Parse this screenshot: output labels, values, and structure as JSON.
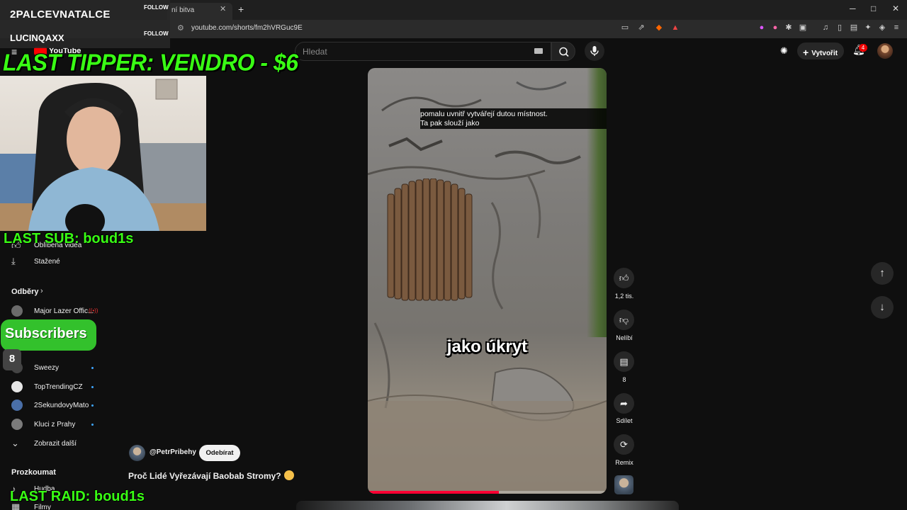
{
  "browser": {
    "tab_title": "ní bitva",
    "tab_close": "✕",
    "new_tab": "+",
    "url": "youtube.com/shorts/fm2hVRGuc9E",
    "win_min": "─",
    "win_max": "□",
    "win_close": "✕"
  },
  "header": {
    "logo_text": "YouTube",
    "search_placeholder": "Hledat",
    "create_label": "Vytvořit",
    "notification_count": "4"
  },
  "sidebar": {
    "partial_item": "Oblíbená videa",
    "downloads": "Stažené",
    "subscriptions_heading": "Odběry",
    "subs": [
      {
        "name": "Major Lazer Offic...",
        "color": "#6b6b6b"
      },
      {
        "name": "Sweezy",
        "color": "#444444"
      },
      {
        "name": "TopTrendingCZ",
        "color": "#e6e6e6"
      },
      {
        "name": "2SekundovyMato",
        "color": "#4a6fa8"
      },
      {
        "name": "Kluci z Prahy",
        "color": "#7b7b7b"
      }
    ],
    "show_more": "Zobrazit další",
    "explore_heading": "Prozkoumat",
    "music": "Hudba",
    "movies": "Filmy"
  },
  "video": {
    "caption_top_line1": "pomalu uvnitř vytvářejí dutou místnost.",
    "caption_top_line2": "Ta pak slouží jako",
    "caption_mid": "jako úkryt",
    "progress": 0.55,
    "channel": "@PetrPribehy",
    "subscribe_label": "Odebírat",
    "title": "Proč Lidé Vyřezávají Baobab Stromy?"
  },
  "actions": {
    "likes": "1,2 tis.",
    "dislike": "Nelíbí",
    "comments": "8",
    "share": "Sdílet",
    "remix": "Remix"
  },
  "overlay": {
    "follower1": "2PALCEVNATALCE",
    "follower2": "LUCINQAXX",
    "follow_label": "FOLLOW",
    "last_tipper": "LAST TIPPER: VENDRO - $6",
    "last_sub": "LAST SUB: boud1s",
    "subscribers_label": "Subscribers",
    "subscribers_count": "8",
    "last_raid": "LAST RAID: boud1s"
  },
  "colors": {
    "accent_green": "#39ff14",
    "yt_red": "#ff0000",
    "background": "#0f0f0f"
  }
}
